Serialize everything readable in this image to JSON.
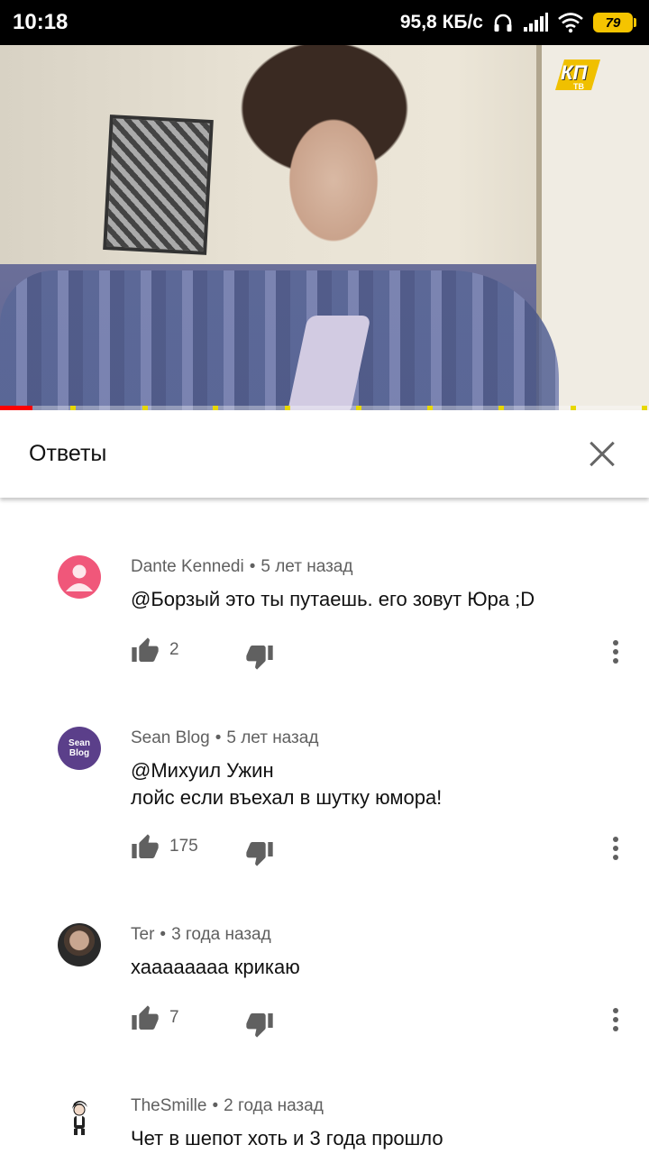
{
  "status_bar": {
    "time": "10:18",
    "speed": "95,8 КБ/с",
    "battery": "79",
    "battery_color": "#f5c400"
  },
  "video": {
    "logo_text": "КП",
    "logo_sub": "ТВ",
    "progress_fraction": 0.05
  },
  "replies_panel": {
    "title": "Ответы",
    "close_icon": "close-icon"
  },
  "comments": [
    {
      "author": "Dante Kennedi",
      "separator": "•",
      "time": "5 лет назад",
      "lines": [
        "@Борзый это ты путаешь. его зовут Юра ;D"
      ],
      "likes": "2"
    },
    {
      "author": "Sean Blog",
      "separator": "•",
      "time": "5 лет назад",
      "lines": [
        "@Михуил Ужин",
        "лойс если въехал в шутку юмора!"
      ],
      "likes": "175",
      "avatar_text": "Sean Blog"
    },
    {
      "author": "Ter",
      "separator": "•",
      "time": "3 года назад",
      "lines": [
        "хаааааааа крикаю"
      ],
      "likes": "7"
    },
    {
      "author": "TheSmille",
      "separator": "•",
      "time": "2 года назад",
      "lines": [
        "Чет в шепот хоть и 3 года прошло"
      ],
      "likes": ""
    }
  ]
}
